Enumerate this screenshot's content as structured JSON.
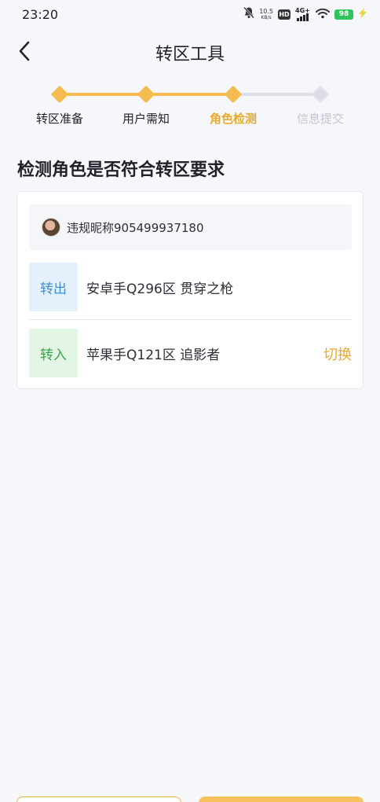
{
  "status_bar": {
    "time": "23:20",
    "net_speed_value": "10.5",
    "net_speed_unit": "KB/s",
    "hd_label": "HD",
    "network_label": "4G+",
    "battery": "98"
  },
  "header": {
    "title": "转区工具"
  },
  "steps": [
    {
      "label": "转区准备",
      "state": "done"
    },
    {
      "label": "用户需知",
      "state": "done"
    },
    {
      "label": "角色检测",
      "state": "current"
    },
    {
      "label": "信息提交",
      "state": "pending"
    }
  ],
  "colors": {
    "accent": "#f5bd4f",
    "pending": "#dde0ea",
    "pending_text": "#c3c6cf",
    "done_text": "#1f2329",
    "current_text": "#e7ab2c"
  },
  "section_title": "检测角色是否符合转区要求",
  "card": {
    "nickname": "违规昵称905499937180",
    "transfer_out": {
      "tag": "转出",
      "server": "安卓手Q296区 贯穿之枪"
    },
    "transfer_in": {
      "tag": "转入",
      "server": "苹果手Q121区 追影者",
      "action": "切换"
    }
  }
}
